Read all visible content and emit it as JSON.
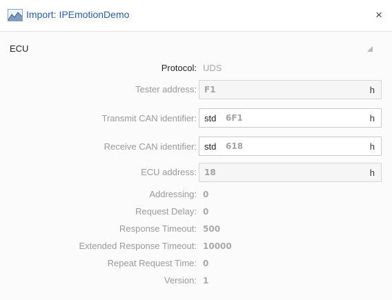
{
  "window": {
    "title": "Import: IPEmotionDemo",
    "close_glyph": "×"
  },
  "section": {
    "title": "ECU"
  },
  "protocol": {
    "label": "Protocol:",
    "value": "UDS"
  },
  "fields": [
    {
      "label": "Tester address:",
      "prefix": "",
      "value": "F1",
      "unit": "h"
    },
    {
      "label": "Transmit CAN identifier:",
      "prefix": "std",
      "value": "6F1",
      "unit": "h"
    },
    {
      "label": "Receive CAN identifier:",
      "prefix": "std",
      "value": "618",
      "unit": "h"
    },
    {
      "label": "ECU address:",
      "prefix": "",
      "value": "18",
      "unit": "h"
    }
  ],
  "properties": [
    {
      "label": "Addressing:",
      "value": "0"
    },
    {
      "label": "Request Delay:",
      "value": "0"
    },
    {
      "label": "Response Timeout:",
      "value": "500"
    },
    {
      "label": "Extended Response Timeout:",
      "value": "10000"
    },
    {
      "label": "Repeat Request Time:",
      "value": "0"
    },
    {
      "label": "Version:",
      "value": "1"
    }
  ],
  "icons": {
    "title_icon": "import-chart-icon",
    "close_icon": "close-icon",
    "collapse_icon": "collapse-triangle-icon"
  },
  "colors": {
    "title": "#2a5d9a",
    "disabled_text": "#a6a6a6",
    "border": "#c9c9c9"
  }
}
